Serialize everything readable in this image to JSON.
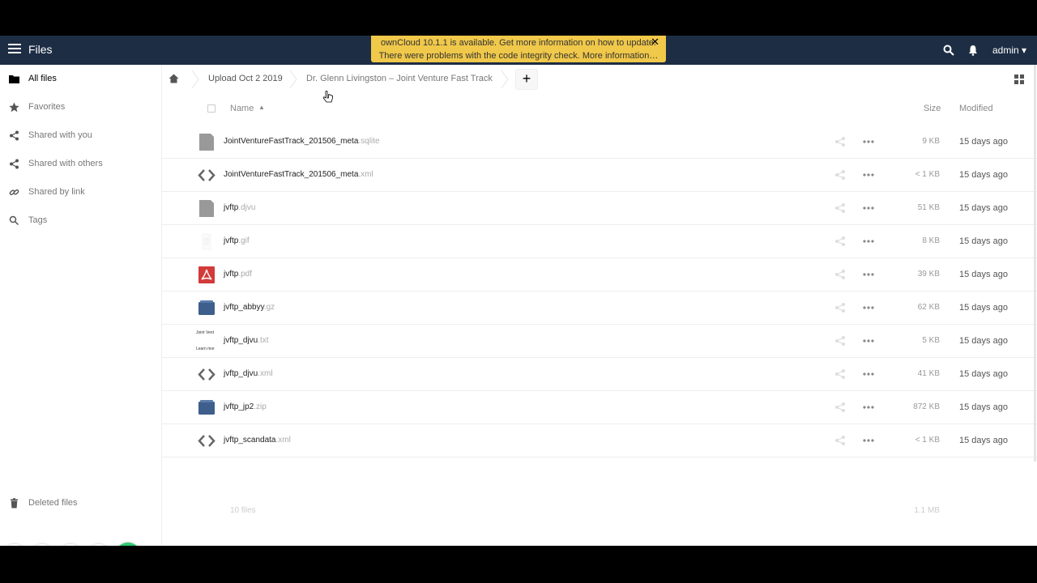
{
  "header": {
    "app_title": "Files",
    "notice_line1": "ownCloud 10.1.1 is available. Get more information on how to update.",
    "notice_line2": "There were problems with the code integrity check. More information…",
    "notice_close": "✕",
    "user": "admin ▾"
  },
  "sidebar": {
    "items": [
      {
        "label": "All files",
        "icon": "folder-icon"
      },
      {
        "label": "Favorites",
        "icon": "star-icon"
      },
      {
        "label": "Shared with you",
        "icon": "share-icon"
      },
      {
        "label": "Shared with others",
        "icon": "share-icon"
      },
      {
        "label": "Shared by link",
        "icon": "link-icon"
      },
      {
        "label": "Tags",
        "icon": "tag-icon"
      }
    ],
    "deleted_files": "Deleted files"
  },
  "breadcrumb": {
    "items": [
      "Upload Oct 2 2019",
      "Dr. Glenn Livingston – Joint Venture Fast Track"
    ],
    "add_label": "+"
  },
  "table": {
    "col_name": "Name",
    "sort_arrow": "▲",
    "col_size": "Size",
    "col_modified": "Modified",
    "rows": [
      {
        "name": "JointVentureFastTrack_201506_meta",
        "ext": ".sqlite",
        "size": "9 KB",
        "modified": "15 days ago",
        "icon": "file-icon"
      },
      {
        "name": "JointVentureFastTrack_201506_meta",
        "ext": ".xml",
        "size": "< 1 KB",
        "modified": "15 days ago",
        "icon": "code-icon"
      },
      {
        "name": "jvftp",
        "ext": ".djvu",
        "size": "51 KB",
        "modified": "15 days ago",
        "icon": "file-icon"
      },
      {
        "name": "jvftp",
        "ext": ".gif",
        "size": "8 KB",
        "modified": "15 days ago",
        "icon": "image-thumbnail"
      },
      {
        "name": "jvftp",
        "ext": ".pdf",
        "size": "39 KB",
        "modified": "15 days ago",
        "icon": "pdf-icon"
      },
      {
        "name": "jvftp_abbyy",
        "ext": ".gz",
        "size": "62 KB",
        "modified": "15 days ago",
        "icon": "archive-icon"
      },
      {
        "name": "jvftp_djvu",
        "ext": ".txt",
        "size": "5 KB",
        "modified": "15 days ago",
        "icon": "text-thumbnail"
      },
      {
        "name": "jvftp_djvu",
        "ext": ".xml",
        "size": "41 KB",
        "modified": "15 days ago",
        "icon": "code-icon"
      },
      {
        "name": "jvftp_jp2",
        "ext": ".zip",
        "size": "872 KB",
        "modified": "15 days ago",
        "icon": "archive-icon"
      },
      {
        "name": "jvftp_scandata",
        "ext": ".xml",
        "size": "< 1 KB",
        "modified": "15 days ago",
        "icon": "code-icon"
      }
    ],
    "summary_count": "10 files",
    "summary_size": "1.1 MB"
  },
  "thumbnails": {
    "text_thumb_line1": "Joint Vent",
    "text_thumb_line2": "Learn mor"
  },
  "colors": {
    "header_bg": "#1d2d44",
    "notice_bg": "#f0c84a",
    "pdf_red": "#d33a3a",
    "archive_blue": "#3e5e8c",
    "confirm_green": "#2ecc71"
  }
}
